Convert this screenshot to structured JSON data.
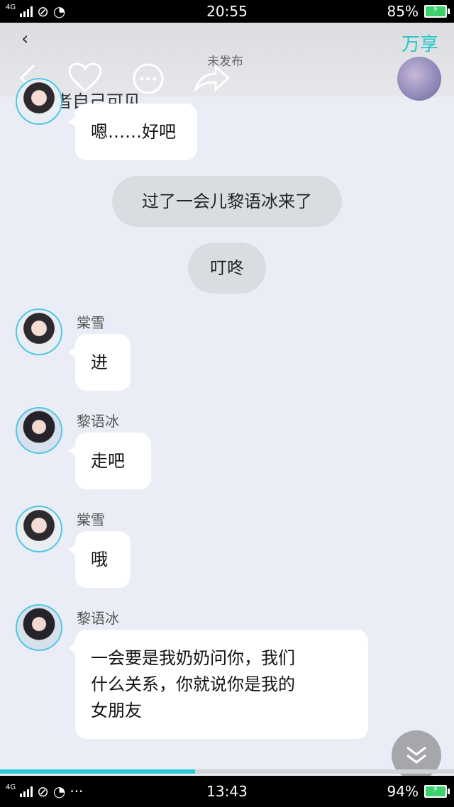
{
  "status_top": {
    "network": "4G",
    "time": "20:55",
    "battery": "85%"
  },
  "status_bottom": {
    "network": "4G",
    "extra": "···",
    "time": "13:43",
    "battery": "94%"
  },
  "overlay": {
    "brand": "万享",
    "unpublished": "未发布",
    "visibility": "仅作者自己可见",
    "icons": [
      "back-icon",
      "heart-icon",
      "more-icon",
      "share-icon"
    ]
  },
  "messages": [
    {
      "type": "bubble",
      "speaker": "",
      "avatar": "girl",
      "text": "嗯……好吧"
    },
    {
      "type": "narration",
      "text": "过了一会儿黎语冰来了"
    },
    {
      "type": "narration",
      "text": "叮咚"
    },
    {
      "type": "bubble",
      "speaker": "棠雪",
      "avatar": "girl",
      "text": "进"
    },
    {
      "type": "bubble",
      "speaker": "黎语冰",
      "avatar": "boy",
      "text": "走吧"
    },
    {
      "type": "bubble",
      "speaker": "棠雪",
      "avatar": "girl",
      "text": "哦"
    },
    {
      "type": "bubble",
      "speaker": "黎语冰",
      "avatar": "boy",
      "lines": [
        "一会要是我奶奶问你，我们",
        "什么关系，你就说你是我的",
        "女朋友"
      ]
    }
  ],
  "reading_progress": 0.43,
  "colors": {
    "accent": "#28c9d6",
    "background": "#eaedf5",
    "avatar_ring": "#50c7e8"
  }
}
